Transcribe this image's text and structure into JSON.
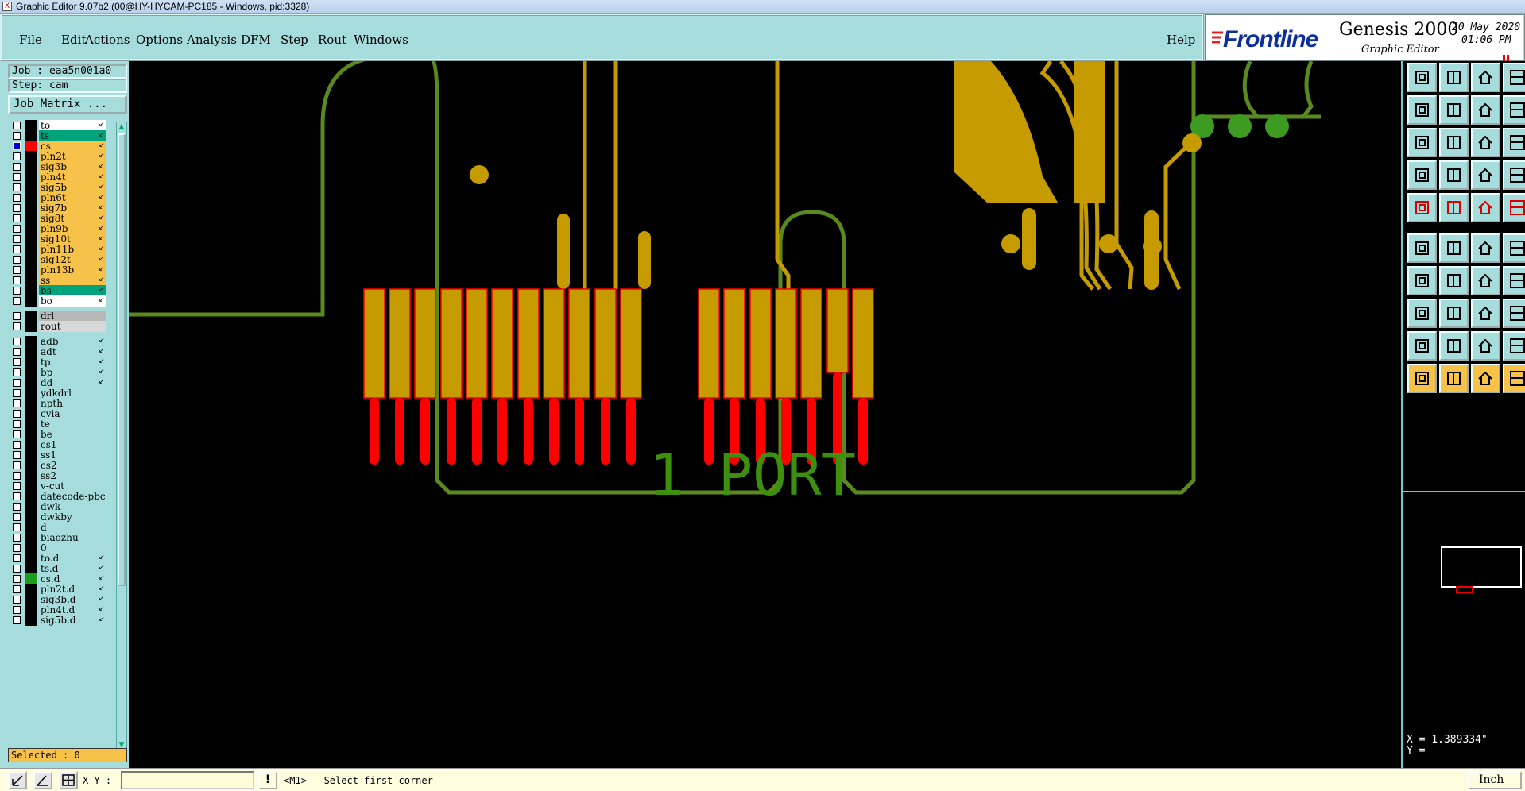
{
  "window": {
    "title": "Graphic Editor 9.07b2 (00@HY-HYCAM-PC185 - Windows, pid:3328)",
    "app_icon": "X"
  },
  "menu": {
    "items": [
      "File",
      "Edit",
      "Actions",
      "Options",
      "Analysis",
      "DFM",
      "Step",
      "Rout",
      "Windows"
    ],
    "help": "Help"
  },
  "brand": {
    "logo": "Frontline",
    "product": "Genesis 2000",
    "subtitle": "Graphic Editor",
    "date": "20 May 2020",
    "time": "01:06 PM",
    "accent_color": "#0d2f9c"
  },
  "left_panel": {
    "job": "Job : eaa5n001a0",
    "step": "Step: cam",
    "job_matrix": "Job Matrix ...",
    "selected": "Selected : 0",
    "layers": [
      {
        "name": "to",
        "color": "#ffffff",
        "bg": "#ffffff",
        "arrow": true
      },
      {
        "name": "ts",
        "color": "#00a47a",
        "bg": "#00a47a",
        "arrow": true
      },
      {
        "name": "cs",
        "color": "#f7c24a",
        "bg": "#f7c24a",
        "arrow": true,
        "active": true,
        "swatch": "#ff0000"
      },
      {
        "name": "pln2t",
        "color": "#f7c24a",
        "bg": "#f7c24a",
        "arrow": true
      },
      {
        "name": "sig3b",
        "color": "#f7c24a",
        "bg": "#f7c24a",
        "arrow": true
      },
      {
        "name": "pln4t",
        "color": "#f7c24a",
        "bg": "#f7c24a",
        "arrow": true
      },
      {
        "name": "sig5b",
        "color": "#f7c24a",
        "bg": "#f7c24a",
        "arrow": true
      },
      {
        "name": "pln6t",
        "color": "#f7c24a",
        "bg": "#f7c24a",
        "arrow": true
      },
      {
        "name": "sig7b",
        "color": "#f7c24a",
        "bg": "#f7c24a",
        "arrow": true
      },
      {
        "name": "sig8t",
        "color": "#f7c24a",
        "bg": "#f7c24a",
        "arrow": true
      },
      {
        "name": "pln9b",
        "color": "#f7c24a",
        "bg": "#f7c24a",
        "arrow": true
      },
      {
        "name": "sig10t",
        "color": "#f7c24a",
        "bg": "#f7c24a",
        "arrow": true
      },
      {
        "name": "pln11b",
        "color": "#f7c24a",
        "bg": "#f7c24a",
        "arrow": true
      },
      {
        "name": "sig12t",
        "color": "#f7c24a",
        "bg": "#f7c24a",
        "arrow": true
      },
      {
        "name": "pln13b",
        "color": "#f7c24a",
        "bg": "#f7c24a",
        "arrow": true
      },
      {
        "name": "ss",
        "color": "#f7c24a",
        "bg": "#f7c24a",
        "arrow": true
      },
      {
        "name": "bs",
        "color": "#00a47a",
        "bg": "#00a47a",
        "arrow": true
      },
      {
        "name": "bo",
        "color": "#ffffff",
        "bg": "#ffffff",
        "arrow": true
      },
      {
        "gap": true
      },
      {
        "name": "drl",
        "color": "#b8b8b8",
        "bg": "#b8b8b8",
        "arrow": false
      },
      {
        "name": "rout",
        "color": "#d8d8d8",
        "bg": "#d8d8d8",
        "arrow": false
      },
      {
        "gap": true
      },
      {
        "name": "adb",
        "color": "#a6dcdc",
        "bg": "#a6dcdc",
        "arrow": true
      },
      {
        "name": "adt",
        "color": "#a6dcdc",
        "bg": "#a6dcdc",
        "arrow": true
      },
      {
        "name": "tp",
        "color": "#a6dcdc",
        "bg": "#a6dcdc",
        "arrow": true
      },
      {
        "name": "bp",
        "color": "#a6dcdc",
        "bg": "#a6dcdc",
        "arrow": true
      },
      {
        "name": "dd",
        "color": "#a6dcdc",
        "bg": "#a6dcdc",
        "arrow": true
      },
      {
        "name": "ydkdrl",
        "color": "#a6dcdc",
        "bg": "#a6dcdc",
        "arrow": false
      },
      {
        "name": "npth",
        "color": "#a6dcdc",
        "bg": "#a6dcdc",
        "arrow": false
      },
      {
        "name": "cvia",
        "color": "#a6dcdc",
        "bg": "#a6dcdc",
        "arrow": false
      },
      {
        "name": "te",
        "color": "#a6dcdc",
        "bg": "#a6dcdc",
        "arrow": false
      },
      {
        "name": "be",
        "color": "#a6dcdc",
        "bg": "#a6dcdc",
        "arrow": false
      },
      {
        "name": "cs1",
        "color": "#a6dcdc",
        "bg": "#a6dcdc",
        "arrow": false
      },
      {
        "name": "ss1",
        "color": "#a6dcdc",
        "bg": "#a6dcdc",
        "arrow": false
      },
      {
        "name": "cs2",
        "color": "#a6dcdc",
        "bg": "#a6dcdc",
        "arrow": false
      },
      {
        "name": "ss2",
        "color": "#a6dcdc",
        "bg": "#a6dcdc",
        "arrow": false
      },
      {
        "name": "v-cut",
        "color": "#a6dcdc",
        "bg": "#a6dcdc",
        "arrow": false
      },
      {
        "name": "datecode-pbc",
        "color": "#a6dcdc",
        "bg": "#a6dcdc",
        "arrow": false
      },
      {
        "name": "dwk",
        "color": "#a6dcdc",
        "bg": "#a6dcdc",
        "arrow": false
      },
      {
        "name": "dwkby",
        "color": "#a6dcdc",
        "bg": "#a6dcdc",
        "arrow": false
      },
      {
        "name": "d",
        "color": "#a6dcdc",
        "bg": "#a6dcdc",
        "arrow": false
      },
      {
        "name": "biaozhu",
        "color": "#a6dcdc",
        "bg": "#a6dcdc",
        "arrow": false
      },
      {
        "name": "0",
        "color": "#a6dcdc",
        "bg": "#a6dcdc",
        "arrow": false
      },
      {
        "name": "to.d",
        "color": "#a6dcdc",
        "bg": "#a6dcdc",
        "arrow": true
      },
      {
        "name": "ts.d",
        "color": "#a6dcdc",
        "bg": "#a6dcdc",
        "arrow": true
      },
      {
        "name": "cs.d",
        "color": "#a6dcdc",
        "bg": "#a6dcdc",
        "arrow": true,
        "swatch": "#1c9e1c"
      },
      {
        "name": "pln2t.d",
        "color": "#a6dcdc",
        "bg": "#a6dcdc",
        "arrow": true
      },
      {
        "name": "sig3b.d",
        "color": "#a6dcdc",
        "bg": "#a6dcdc",
        "arrow": true
      },
      {
        "name": "pln4t.d",
        "color": "#a6dcdc",
        "bg": "#a6dcdc",
        "arrow": true
      },
      {
        "name": "sig5b.d",
        "color": "#a6dcdc",
        "bg": "#a6dcdc",
        "arrow": true
      }
    ]
  },
  "canvas": {
    "label_text": "1 PORT",
    "colors": {
      "copper": "#c69b00",
      "outline": "#5a8a1e",
      "red": "#ff0000",
      "label": "#3d8f0e"
    }
  },
  "coords": {
    "x_label": "X = 1.389334\"",
    "y_label": "Y ="
  },
  "cmdbar": {
    "xy_label": "X Y :",
    "xy_value": "",
    "alert": "!",
    "prompt": "<M1> - Select first corner",
    "units": "Inch"
  },
  "toolbar_icons": [
    "zoom-home-icon",
    "zoom-back-icon",
    "home-icon",
    "window-icon",
    "zoom-in-icon",
    "zoom-out-icon",
    "pan-icon",
    "stretch-icon",
    "fit-icon",
    "center-icon",
    "scale-1-2-icon",
    "help-icon",
    "measure-icon",
    "grid-icon",
    "snap-icon",
    "palette-icon",
    "pad-icon",
    "rectangle-icon",
    "line-icon",
    "circle-icon",
    "connect-icon",
    "delete-icon",
    "add-icon",
    "move-icon",
    "angle-icon",
    "slash-icon",
    "rotate-icon",
    "text-icon",
    "symbol-icon",
    "minus-icon",
    "resize-icon",
    "copy-icon",
    "triangle-icon",
    "mirror-icon",
    "polygon-icon",
    "arc-icon",
    "select-icon",
    "select-box-icon",
    "select-net-icon",
    "select-pin-icon"
  ]
}
